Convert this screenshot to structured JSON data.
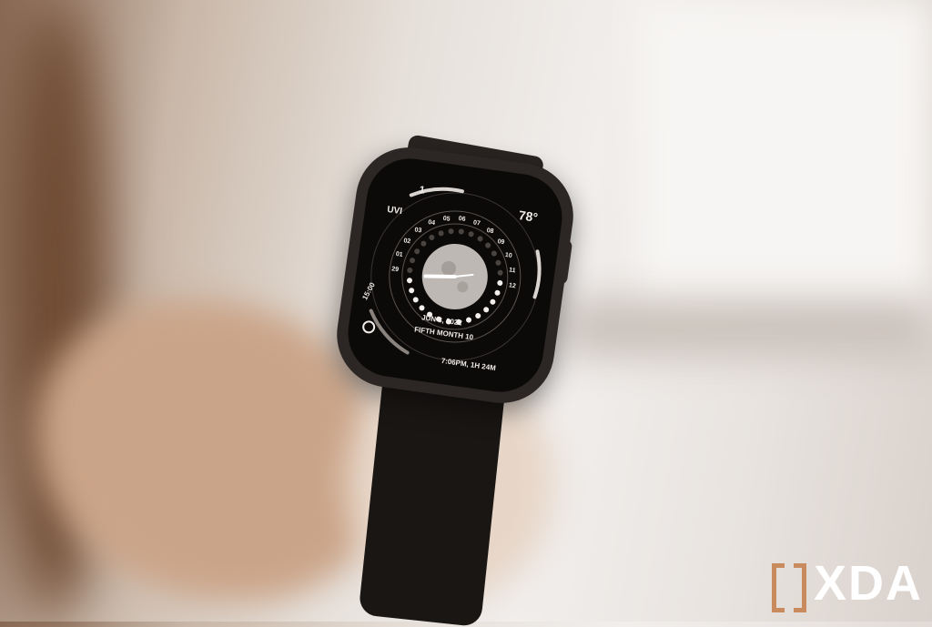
{
  "watch_face": {
    "uv_label": "UVI",
    "uv_value": "1",
    "temperature": "78°",
    "date": "JUN 8, 2022",
    "lunar_month": "FIFTH MONTH 10",
    "time_line": "7:06PM, 1H 24M",
    "time_marker": "15:00",
    "day_ring": [
      "29",
      "01",
      "02",
      "03",
      "04",
      "05",
      "06",
      "07",
      "08",
      "09",
      "10",
      "11",
      "12"
    ]
  },
  "watermark": {
    "brand": "XDA"
  }
}
